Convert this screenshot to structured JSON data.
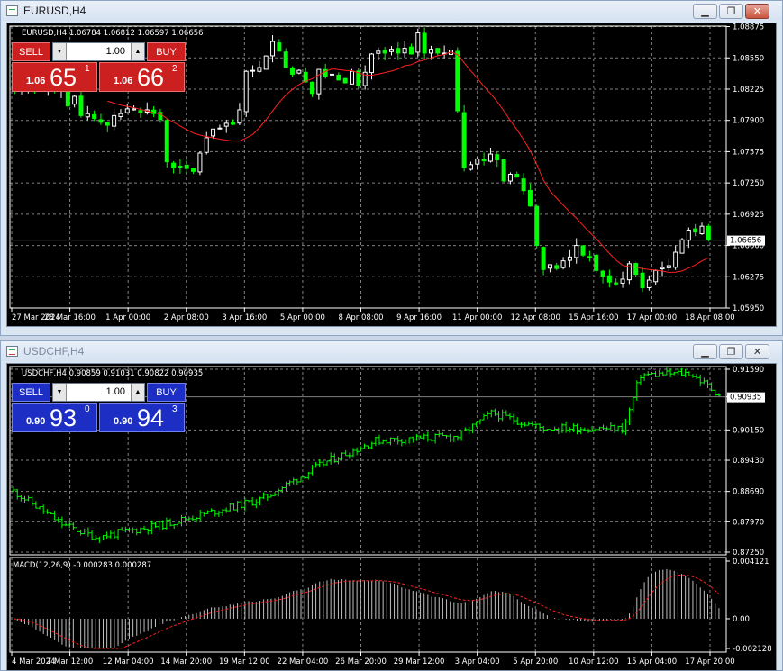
{
  "windows": [
    {
      "title": "EURUSD,H4",
      "header": "EURUSD,H4  1.06784 1.06812 1.06597 1.06656",
      "trade": {
        "sell": "SELL",
        "buy": "BUY",
        "lot": "1.00",
        "sell_small": "1.06",
        "sell_big": "65",
        "sell_sup": "1",
        "buy_small": "1.06",
        "buy_big": "66",
        "buy_sup": "2"
      },
      "price_axis": [
        "1.08875",
        "1.08550",
        "1.08225",
        "1.07900",
        "1.07575",
        "1.07250",
        "1.06925",
        "1.06600",
        "1.06275",
        "1.05950"
      ],
      "current_price": "1.06656",
      "time_axis": [
        "27 Mar 2024",
        "28 Mar 16:00",
        "1 Apr 00:00",
        "2 Apr 08:00",
        "3 Apr 16:00",
        "5 Apr 00:00",
        "8 Apr 08:00",
        "9 Apr 16:00",
        "11 Apr 00:00",
        "12 Apr 08:00",
        "15 Apr 16:00",
        "17 Apr 00:00",
        "18 Apr 08:00"
      ],
      "colors": {
        "bull": "#ffffff",
        "bear": "#00ff00",
        "ma": "#ff2020"
      }
    },
    {
      "title": "USDCHF,H4",
      "header": "USDCHF,H4  0.90859 0.91031 0.90822 0.90935",
      "trade": {
        "sell": "SELL",
        "buy": "BUY",
        "lot": "1.00",
        "sell_small": "0.90",
        "sell_big": "93",
        "sell_sup": "0",
        "buy_small": "0.90",
        "buy_big": "94",
        "buy_sup": "3"
      },
      "price_axis": [
        "0.91590",
        "0.90935",
        "0.90150",
        "0.89430",
        "0.88690",
        "0.87970",
        "0.87250"
      ],
      "current_price": "0.90935",
      "macd_header": "MACD(12,26,9) -0.000283 0.000287",
      "macd_axis": [
        "0.004121",
        "0.00",
        "-0.002128"
      ],
      "time_axis": [
        "4 Mar 2024",
        "7 Mar 12:00",
        "12 Mar 04:00",
        "14 Mar 20:00",
        "19 Mar 12:00",
        "22 Mar 04:00",
        "26 Mar 20:00",
        "29 Mar 12:00",
        "3 Apr 04:00",
        "5 Apr 20:00",
        "10 Apr 12:00",
        "15 Apr 04:00",
        "17 Apr 20:00"
      ],
      "colors": {
        "bar": "#00ff00",
        "macd": "#c0c0c0",
        "signal": "#ff2020"
      }
    }
  ],
  "icons": [
    "minimize-icon",
    "restore-icon",
    "close-icon",
    "chart-window-icon"
  ],
  "chart_data": [
    {
      "type": "candlestick",
      "title": "EURUSD,H4",
      "ylim": [
        1.0595,
        1.0888
      ],
      "close": [
        1.0822,
        1.0825,
        1.0826,
        1.082,
        1.0821,
        1.0824,
        1.0822,
        1.0826,
        1.0805,
        1.0815,
        1.0795,
        1.0797,
        1.0792,
        1.0788,
        1.0785,
        1.0795,
        1.0797,
        1.0802,
        1.0802,
        1.0798,
        1.0801,
        1.0797,
        1.0791,
        1.0747,
        1.0741,
        1.0742,
        1.074,
        1.0737,
        1.0756,
        1.0772,
        1.0781,
        1.0782,
        1.0787,
        1.0786,
        1.0801,
        1.0841,
        1.0842,
        1.0845,
        1.0857,
        1.0872,
        1.0862,
        1.0845,
        1.0838,
        1.0842,
        1.083,
        1.0818,
        1.0843,
        1.0836,
        1.0838,
        1.0832,
        1.0829,
        1.0841,
        1.0826,
        1.084,
        1.0859,
        1.0862,
        1.086,
        1.0864,
        1.086,
        1.0865,
        1.0859,
        1.0881,
        1.086,
        1.0864,
        1.086,
        1.086,
        1.0863,
        1.08,
        1.0741,
        1.0744,
        1.075,
        1.0748,
        1.0755,
        1.0749,
        1.0727,
        1.0734,
        1.0731,
        1.0717,
        1.0701,
        1.066,
        1.0635,
        1.064,
        1.0636,
        1.0644,
        1.0648,
        1.066,
        1.065,
        1.0648,
        1.0634,
        1.0628,
        1.0622,
        1.062,
        1.0625,
        1.0641,
        1.063,
        1.0616,
        1.0624,
        1.0634,
        1.0637,
        1.0639,
        1.0653,
        1.0666,
        1.0676,
        1.0674,
        1.068,
        1.0666
      ]
    },
    {
      "type": "bar",
      "title": "USDCHF,H4",
      "ylim": [
        0.8725,
        0.9159
      ],
      "indicator": "MACD(12,26,9)",
      "macd_ylim": [
        -0.002128,
        0.004121
      ]
    }
  ]
}
